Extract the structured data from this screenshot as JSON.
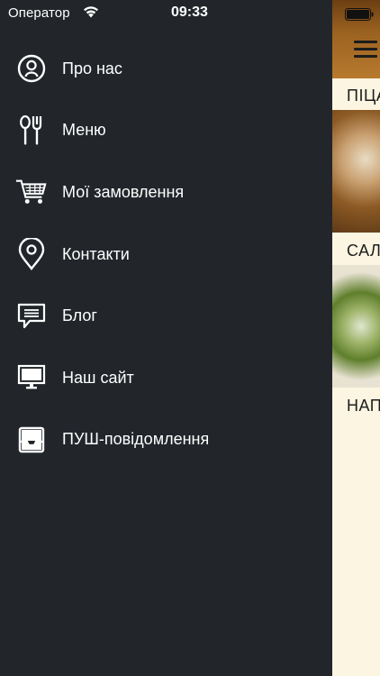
{
  "status_bar": {
    "carrier": "Оператор",
    "time": "09:33"
  },
  "menu": {
    "items": [
      {
        "label": "Про нас",
        "icon": "user-circle-icon"
      },
      {
        "label": "Меню",
        "icon": "spoon-fork-icon"
      },
      {
        "label": "Мої замовлення",
        "icon": "cart-icon"
      },
      {
        "label": "Контакти",
        "icon": "map-pin-icon"
      },
      {
        "label": "Блог",
        "icon": "chat-bubble-icon"
      },
      {
        "label": "Наш сайт",
        "icon": "monitor-icon"
      },
      {
        "label": "ПУШ-повідомлення",
        "icon": "inbox-icon"
      }
    ]
  },
  "content": {
    "categories": [
      "ПІЦА",
      "САЛАТИ",
      "НАПОЇ"
    ]
  },
  "colors": {
    "drawer_bg": "#22262b",
    "content_bg": "#fbf5e1",
    "header_wood": "#9a6120"
  }
}
